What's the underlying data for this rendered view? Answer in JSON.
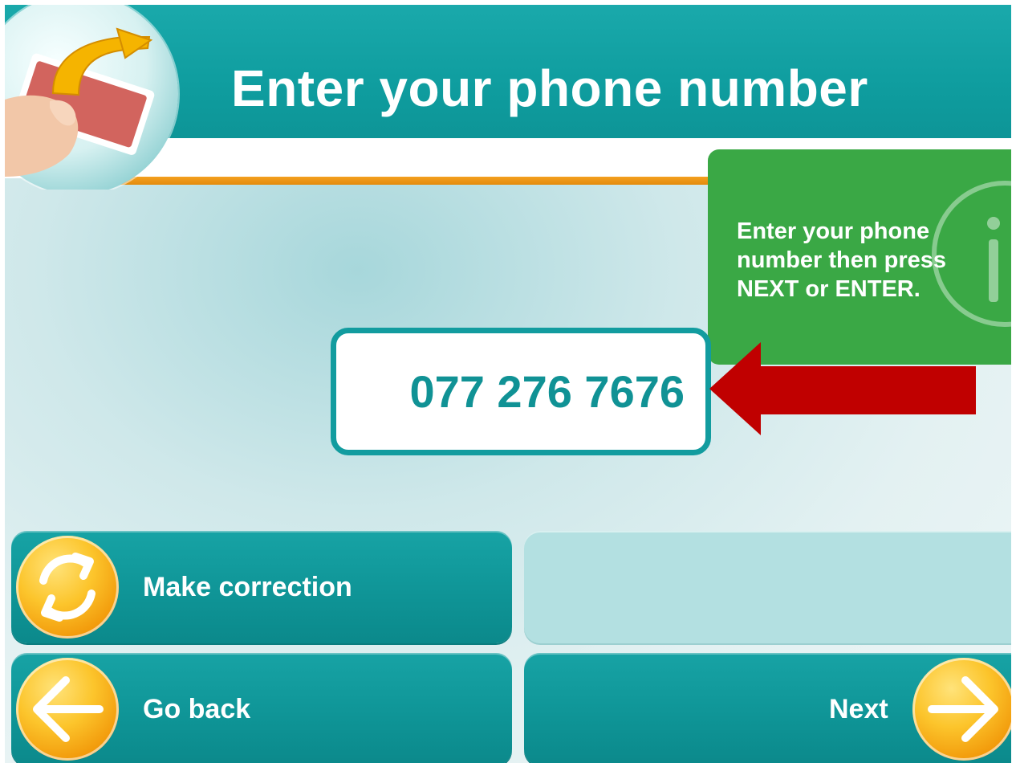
{
  "header": {
    "title": "Enter your phone number"
  },
  "info": {
    "text": "Enter your phone\nnumber then press\nNEXT or ENTER.",
    "icon": "info-icon"
  },
  "phone": {
    "value": "077 276 7676"
  },
  "buttons": {
    "make_correction": "Make correction",
    "go_back": "Go back",
    "next": "Next"
  },
  "colors": {
    "teal": "#0f9d9f",
    "orange": "#f29a0b",
    "green_panel": "#3aa845",
    "arrow_red": "#c00000"
  }
}
